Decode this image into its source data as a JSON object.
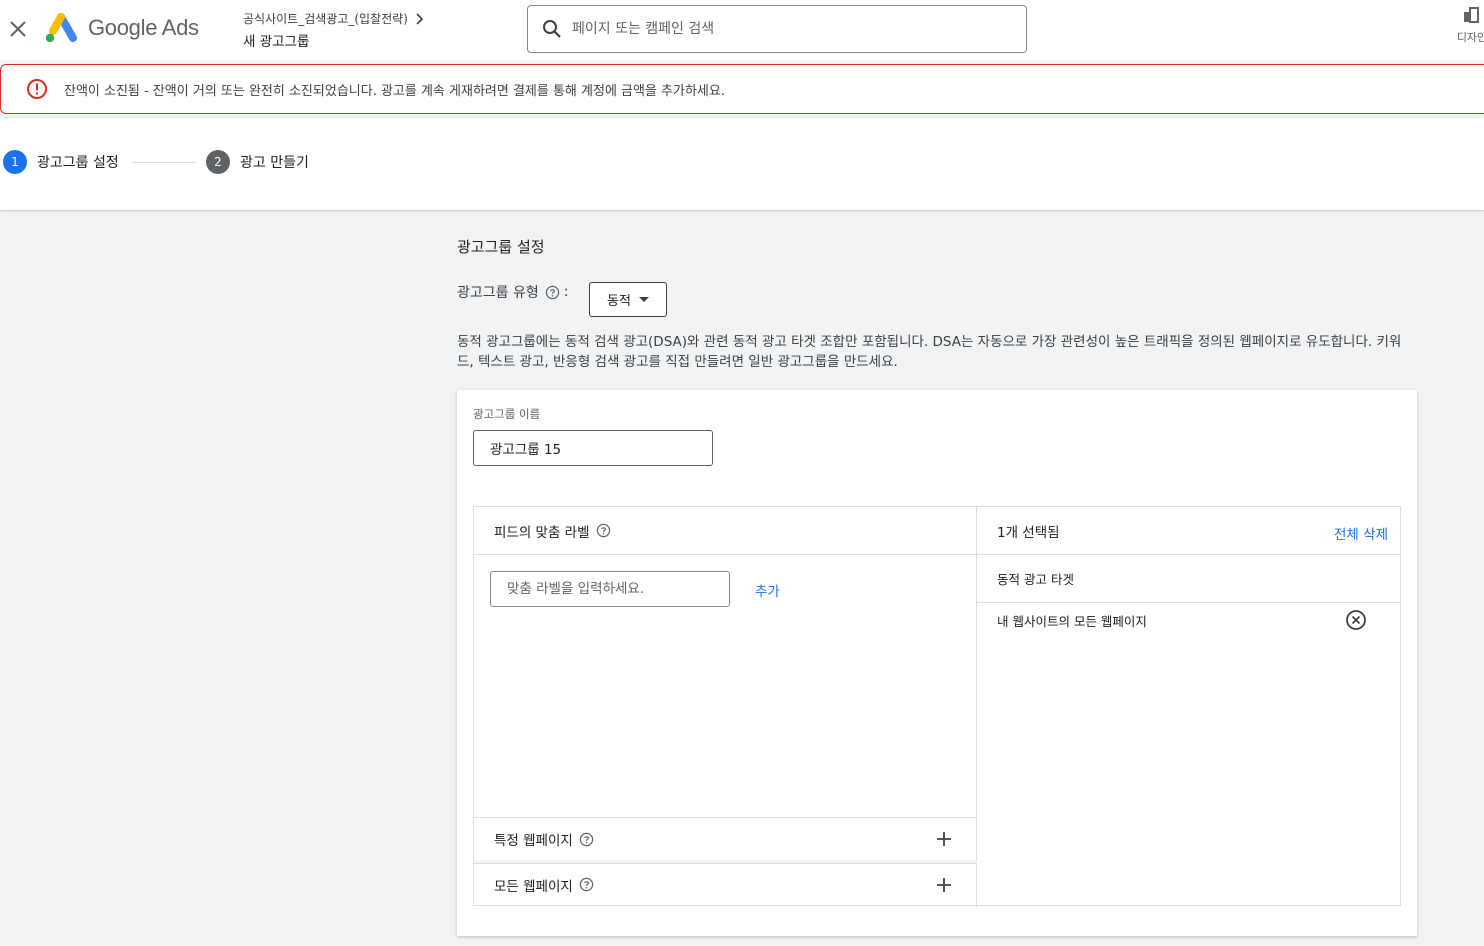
{
  "header": {
    "brand": "Google Ads",
    "breadcrumb_parent": "공식사이트_검색광고_(입찰전략)",
    "breadcrumb_current": "새 광고그룹",
    "search_placeholder": "페이지 또는 캠페인 검색",
    "design_tool_label": "디자인"
  },
  "alert": {
    "message": "잔액이 소진됨 - 잔액이 거의 또는 완전히 소진되었습니다. 광고를 계속 게재하려면 결제를 통해 계정에 금액을 추가하세요."
  },
  "stepper": {
    "steps": [
      {
        "num": "1",
        "label": "광고그룹 설정"
      },
      {
        "num": "2",
        "label": "광고 만들기"
      }
    ]
  },
  "main": {
    "section_title": "광고그룹 설정",
    "type_label": "광고그룹 유형",
    "type_colon": ":",
    "type_value": "동적",
    "description": "동적 광고그룹에는 동적 검색 광고(DSA)와 관련 동적 광고 타겟 조합만 포함됩니다. DSA는 자동으로 가장 관련성이 높은 트래픽을 정의된 웹페이지로 유도합니다. 키워드, 텍스트 광고, 반응형 검색 광고를 직접 만들려면 일반 광고그룹을 만드세요.",
    "name_label": "광고그룹 이름",
    "name_value": "광고그룹 15"
  },
  "targets": {
    "left_title": "피드의 맞춤 라벨",
    "label_placeholder": "맞춤 라벨을 입력하세요.",
    "add_label": "추가",
    "row_specific": "특정 웹페이지",
    "row_all": "모든 웹페이지",
    "selected_count": "1개 선택됨",
    "clear_all": "전체 삭제",
    "group_title": "동적 광고 타겟",
    "selected_item": "내 웹사이트의 모든 웹페이지"
  },
  "colors": {
    "accent": "#1a73e8",
    "error": "#d93025"
  }
}
